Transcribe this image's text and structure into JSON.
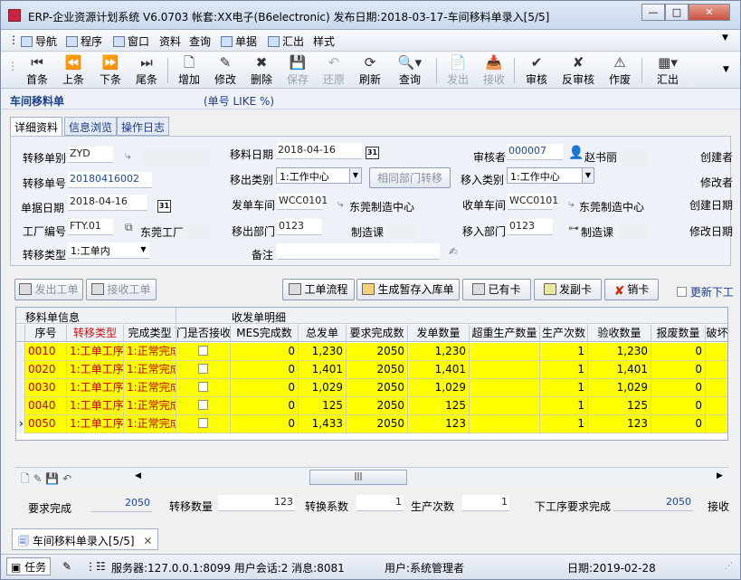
{
  "window": {
    "title": "ERP-企业资源计划系统 V6.0703 帐套:XX电子(B6electronic) 发布日期:2018-03-17-车间移料单录入[5/5]"
  },
  "menu": {
    "items": [
      "导航",
      "程序",
      "窗口",
      "资料",
      "查询",
      "单据",
      "汇出",
      "样式"
    ]
  },
  "toolbar": {
    "buttons": [
      "首条",
      "上条",
      "下条",
      "尾条",
      "增加",
      "修改",
      "删除",
      "保存",
      "还原",
      "刷新",
      "查询",
      "发出",
      "接收",
      "审核",
      "反审核",
      "作废",
      "汇出"
    ]
  },
  "header": {
    "title": "车间移料单",
    "filter": "(单号 LIKE %)"
  },
  "tabs": [
    "详细资料",
    "信息浏览",
    "操作日志"
  ],
  "form": {
    "transfer_type_label": "转移单别",
    "transfer_type": "ZYD",
    "move_date_label": "移料日期",
    "move_date": "2018-04-16",
    "reviewer_label": "审核者",
    "reviewer_code": "000007",
    "reviewer_name": "赵书丽",
    "creator_label": "创建者",
    "transfer_no_label": "转移单号",
    "transfer_no": "20180416002",
    "out_type_label": "移出类别",
    "out_type": "1:工作中心",
    "same_dept_btn": "相同部门转移",
    "in_type_label": "移入类别",
    "in_type": "1:工作中心",
    "modifier_label": "修改者",
    "doc_date_label": "单据日期",
    "doc_date": "2018-04-16",
    "send_ws_label": "发单车间",
    "send_ws": "WCC0101",
    "send_ws_name": "东莞制造中心",
    "recv_ws_label": "收单车间",
    "recv_ws": "WCC0101",
    "recv_ws_name": "东莞制造中心",
    "create_date_label": "创建日期",
    "factory_label": "工厂编号",
    "factory": "FTY.01",
    "factory_name": "东莞工厂",
    "out_dept_label": "移出部门",
    "out_dept": "0123",
    "out_dept_name": "制造课",
    "in_dept_label": "移入部门",
    "in_dept": "0123",
    "in_dept_name": "制造课",
    "modify_date_label": "修改日期",
    "transfer_kind_label": "转移类型",
    "transfer_kind": "1:工单内",
    "remark_label": "备注",
    "remark": ""
  },
  "actions": {
    "send_wo": "发出工单",
    "recv_wo": "接收工单",
    "wo_flow": "工单流程",
    "gen_stock": "生成暂存入库单",
    "has_card": "已有卡",
    "issue_card": "发副卡",
    "cancel_card": "销卡",
    "refresh_next": "更新下工"
  },
  "grid": {
    "group1": "移料单信息",
    "group2": "收发单明细",
    "columns": [
      "序号",
      "转移类型",
      "完成类型",
      "门是否接收",
      "MES完成数",
      "总发单",
      "要求完成数",
      "发单数量",
      "超重生产数量",
      "生产次数",
      "验收数量",
      "报废数量",
      "破坏"
    ],
    "rows": [
      [
        "0010",
        "1:工单工序",
        "1:正常完成",
        "",
        "0",
        "1,230",
        "2050",
        "1,230",
        "",
        "1",
        "1,230",
        "0",
        ""
      ],
      [
        "0020",
        "1:工单工序",
        "1:正常完成",
        "",
        "0",
        "1,401",
        "2050",
        "1,401",
        "",
        "1",
        "1,401",
        "0",
        ""
      ],
      [
        "0030",
        "1:工单工序",
        "1:正常完成",
        "",
        "0",
        "1,029",
        "2050",
        "1,029",
        "",
        "1",
        "1,029",
        "0",
        ""
      ],
      [
        "0040",
        "1:工单工序",
        "1:正常完成",
        "",
        "0",
        "125",
        "2050",
        "125",
        "",
        "1",
        "125",
        "0",
        ""
      ],
      [
        "0050",
        "1:工单工序",
        "1:正常完成",
        "",
        "0",
        "1,433",
        "2050",
        "123",
        "",
        "1",
        "123",
        "0",
        ""
      ]
    ]
  },
  "bottom": {
    "req_label": "要求完成",
    "req": "2050",
    "qty_label": "转移数量",
    "qty": "123",
    "ratio_label": "转换系数",
    "ratio": "1",
    "times_label": "生产次数",
    "times": "1",
    "next_req_label": "下工序要求完成",
    "next_req": "2050",
    "recv_label": "接收"
  },
  "doctab": {
    "label": "车间移料单录入[5/5]"
  },
  "status": {
    "task": "任务",
    "server": "服务器:127.0.0.1:8099 用户会话:2 消息:8081",
    "user": "用户:系统管理者",
    "date": "日期:2019-02-28"
  }
}
